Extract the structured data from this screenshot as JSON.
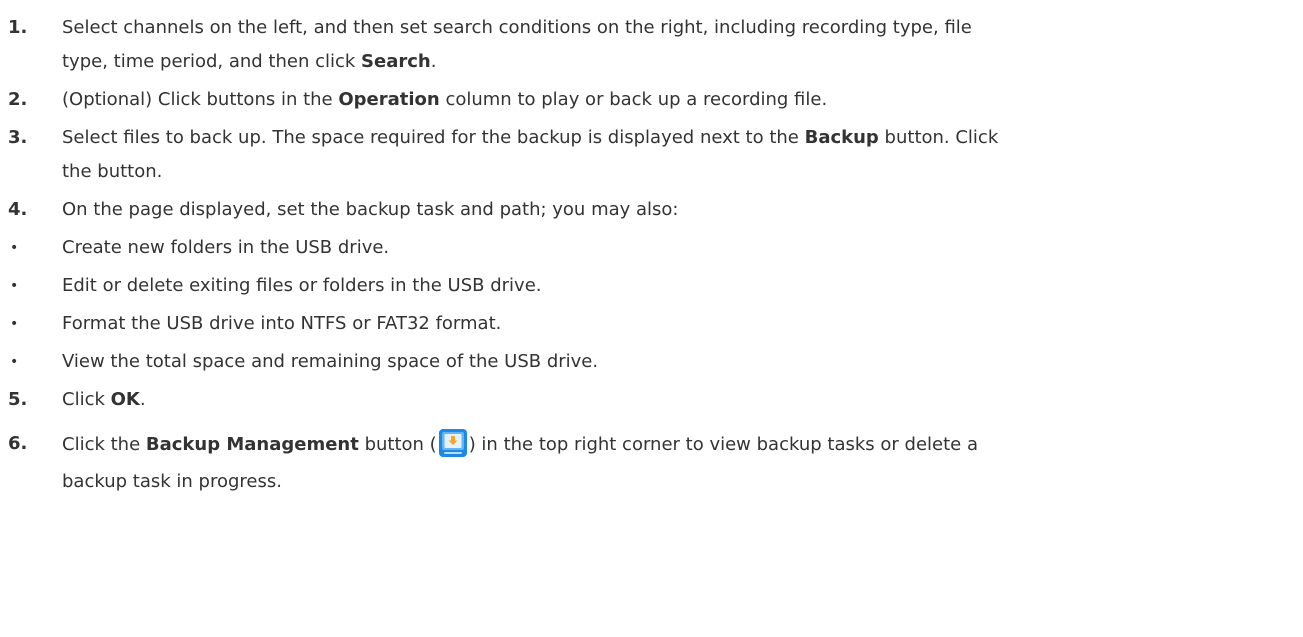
{
  "steps": [
    {
      "number": "1.",
      "parts": {
        "a": "Select channels on the left, and then set search conditions on the right, including recording type, file",
        "b": "type, time period, and then click ",
        "c": "Search",
        "d": "."
      }
    },
    {
      "number": "2.",
      "parts": {
        "a": "(Optional) Click buttons in the ",
        "b": "Operation",
        "c": " column to play or back up a recording file."
      }
    },
    {
      "number": "3.",
      "parts": {
        "a": "Select files to back up. The space required for the backup is displayed next to the ",
        "b": "Backup",
        "c": " button. Click",
        "d": "the button."
      }
    },
    {
      "number": "4.",
      "parts": {
        "a": "On the page displayed, set the backup task and path; you may also:"
      }
    },
    {
      "number": "5.",
      "parts": {
        "a": "Click ",
        "b": "OK",
        "c": "."
      }
    },
    {
      "number": "6.",
      "parts": {
        "a": "Click the ",
        "b": "Backup Management",
        "c": " button (",
        "d": ") in the top right corner to view backup tasks or delete a",
        "e": "backup task in progress."
      }
    }
  ],
  "bullets": [
    "Create new folders in the USB drive.",
    "Edit or delete exiting files or folders in the USB drive.",
    "Format the USB drive into NTFS or FAT32 format.",
    "View the total space and remaining space of the USB drive."
  ],
  "bullet_symbol": "•",
  "icons": {
    "backup_management": "backup-management-icon"
  },
  "colors": {
    "text": "#333333",
    "icon_blue": "#1e88e5",
    "icon_light": "#64b5f6",
    "icon_arrow": "#f5a623"
  }
}
